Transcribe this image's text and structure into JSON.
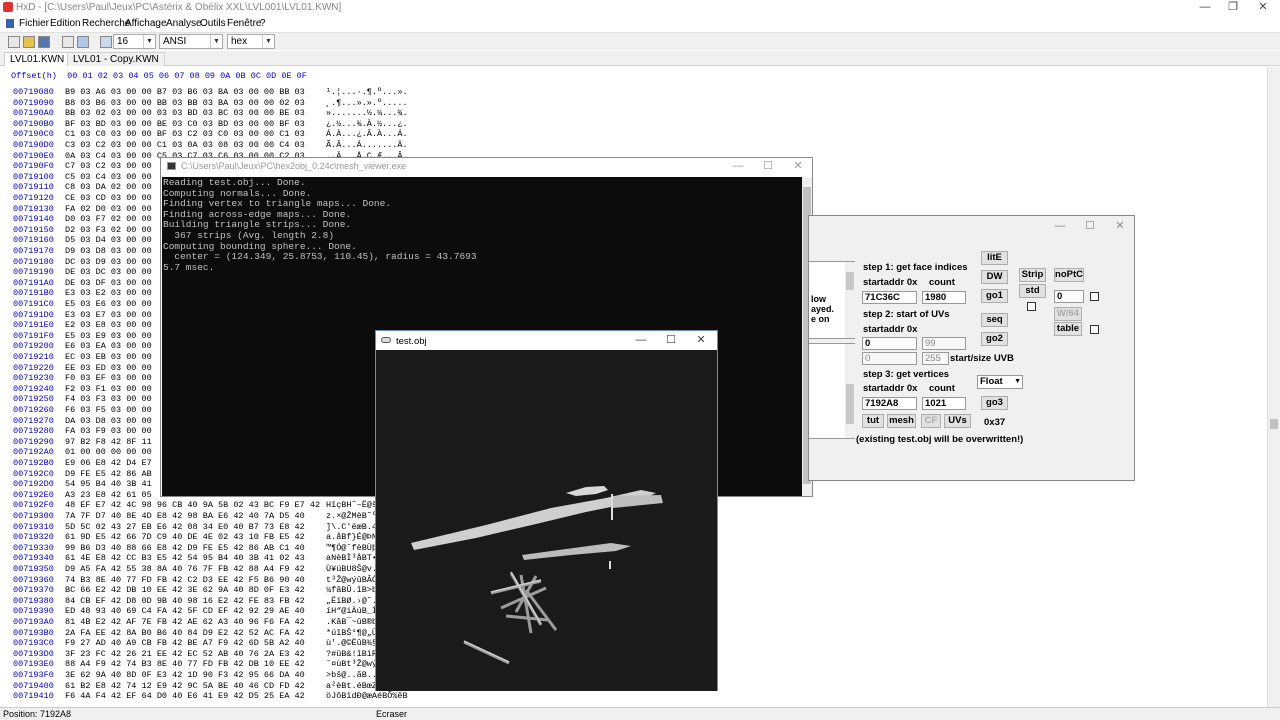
{
  "hxd": {
    "title": "HxD - [C:\\Users\\Paul\\Jeux\\PC\\Astérix & Obélix XXL\\LVL001\\LVL01.KWN]",
    "menu": [
      "Fichier",
      "Edition",
      "Recherche",
      "Affichage",
      "Analyse",
      "Outils",
      "Fenêtre",
      "?"
    ],
    "toolbar": {
      "columns": "16",
      "charset": "ANSI",
      "mode": "hex"
    },
    "tabs": [
      "LVL01.KWN",
      "LVL01 - Copy.KWN"
    ],
    "header": "Offset(h)  00 01 02 03 04 05 06 07 08 09 0A 0B 0C 0D 0E 0F",
    "rows": [
      {
        "o": "00719080",
        "h": "B9 03 A6 03 00 00 B7 03 B6 03 BA 03 00 00 BB 03",
        "t": "¹.¦...·.¶.º...»."
      },
      {
        "o": "00719090",
        "h": "B8 03 B6 03 00 00 BB 03 BB 03 BA 03 00 00 02 03",
        "t": "¸.¶...».».º....."
      },
      {
        "o": "007190A0",
        "h": "BB 03 02 03 00 00 03 03 BD 03 BC 03 00 00 BE 03",
        "t": "».......½.¼...¾."
      },
      {
        "o": "007190B0",
        "h": "BF 03 BD 03 00 00 BE 03 C0 03 BD 03 00 00 BF 03",
        "t": "¿.½...¾.À.½...¿."
      },
      {
        "o": "007190C0",
        "h": "C1 03 C0 03 00 00 BF 03 C2 03 C0 03 00 00 C1 03",
        "t": "Á.À...¿.Â.À...Á."
      },
      {
        "o": "007190D0",
        "h": "C3 03 C2 03 00 00 C1 03 0A 03 08 03 00 00 C4 03",
        "t": "Ã.Â...Á.......Ä."
      },
      {
        "o": "007190E0",
        "h": "0A 03 C4 03 00 00 C5 03 C7 03 C6 03 00 00 C2 03",
        "t": "..Ä...Å.Ç.Æ...Â."
      },
      {
        "o": "007190F0",
        "h": "C7 03 C2 03 00 00",
        "t": ""
      },
      {
        "o": "00719100",
        "h": "C5 03 C4 03 00 00",
        "t": ""
      },
      {
        "o": "00719110",
        "h": "C8 03 DA 02 00 00",
        "t": ""
      },
      {
        "o": "00719120",
        "h": "CE 03 CD 03 00 00",
        "t": ""
      },
      {
        "o": "00719130",
        "h": "FA 02 D0 03 00 00",
        "t": ""
      },
      {
        "o": "00719140",
        "h": "D0 03 F7 02 00 00",
        "t": ""
      },
      {
        "o": "00719150",
        "h": "D2 03 F3 02 00 00",
        "t": ""
      },
      {
        "o": "00719160",
        "h": "D5 03 D4 03 00 00",
        "t": ""
      },
      {
        "o": "00719170",
        "h": "D9 03 D8 03 00 00",
        "t": ""
      },
      {
        "o": "00719180",
        "h": "DC 03 D9 03 00 00",
        "t": ""
      },
      {
        "o": "00719190",
        "h": "DE 03 DC 03 00 00",
        "t": ""
      },
      {
        "o": "007191A0",
        "h": "DE 03 DF 03 00 00",
        "t": ""
      },
      {
        "o": "007191B0",
        "h": "E3 03 E2 03 00 00",
        "t": ""
      },
      {
        "o": "007191C0",
        "h": "E5 03 E6 03 00 00",
        "t": ""
      },
      {
        "o": "007191D0",
        "h": "E3 03 E7 03 00 00",
        "t": ""
      },
      {
        "o": "007191E0",
        "h": "E2 03 E8 03 00 00",
        "t": ""
      },
      {
        "o": "007191F0",
        "h": "E5 03 E9 03 00 00",
        "t": ""
      },
      {
        "o": "00719200",
        "h": "E6 03 EA 03 00 00",
        "t": ""
      },
      {
        "o": "00719210",
        "h": "EC 03 EB 03 00 00",
        "t": ""
      },
      {
        "o": "00719220",
        "h": "EE 03 ED 03 00 00",
        "t": ""
      },
      {
        "o": "00719230",
        "h": "F0 03 EF 03 00 00",
        "t": ""
      },
      {
        "o": "00719240",
        "h": "F2 03 F1 03 00 00",
        "t": ""
      },
      {
        "o": "00719250",
        "h": "F4 03 F3 03 00 00",
        "t": ""
      },
      {
        "o": "00719260",
        "h": "F6 03 F5 03 00 00",
        "t": ""
      },
      {
        "o": "00719270",
        "h": "DA 03 D8 03 00 00",
        "t": ""
      },
      {
        "o": "00719280",
        "h": "FA 03 F9 03 00 00",
        "t": ""
      },
      {
        "o": "00719290",
        "h": "97 B2 F8 42 8F 11",
        "t": ""
      },
      {
        "o": "007192A0",
        "h": "01 00 00 00 00 00",
        "t": ""
      },
      {
        "o": "007192B0",
        "h": "E9 06 E8 42 D4 E7",
        "t": ""
      },
      {
        "o": "007192C0",
        "h": "D9 FE E5 42 86 AB",
        "t": ""
      },
      {
        "o": "007192D0",
        "h": "54 95 B4 40 3B 41",
        "t": ""
      },
      {
        "o": "007192E0",
        "h": "A3 23 E8 42 61 05",
        "t": ""
      },
      {
        "o": "007192F0",
        "h": "48 EF E7 42 4C 98 96 CB 40 9A 5B 02 43 BC F9 E7 42",
        "t": "HïçBH˜–Ë@š[.C¼ùçB"
      },
      {
        "o": "00719300",
        "h": "7A 7F D7 40 8E 4D E8 42 98 BA E6 42 40 7A D5 40",
        "t": "z.×@ŽMèB˜ºæB@zÕ@"
      },
      {
        "o": "00719310",
        "h": "5D 5C 02 43 27 EB E6 42 08 34 E0 40 B7 73 E8 42",
        "t": "]\\.C'ëæB.4à@·sèB"
      },
      {
        "o": "00719320",
        "h": "61 9D E5 42 66 7D C9 40 DE 4E 02 43 10 FB E5 42",
        "t": "a.åBf}É@ÞN.C.ûåB"
      },
      {
        "o": "00719330",
        "h": "99 B6 D3 40 88 66 E8 42 D9 FE E5 42 86 AB C1 40",
        "t": "™¶Ó@ˆfèBÙþåB†«Á@"
      },
      {
        "o": "00719340",
        "h": "61 4E E8 42 CC B3 E5 42 54 95 B4 40 3B 41 02 43",
        "t": "aNèBÌ³åBT•´@;A.C"
      },
      {
        "o": "00719350",
        "h": "D9 A5 FA 42 55 38 8A 40 76 7F FB 42 88 A4 F9 42",
        "t": "Ù¥úBU8Š@v.ûBˆ¤ùB"
      },
      {
        "o": "00719360",
        "h": "74 B3 8E 40 77 FD FB 42 C2 D3 EE 42 F5 B6 90 40",
        "t": "t³Ž@wýûBÂÓîBõ¶.@"
      },
      {
        "o": "00719370",
        "h": "BC 66 E2 42 DB 10 EE 42 3E 62 9A 40 8D 0F E3 42",
        "t": "¼fâBÛ.îB>bš@..ãB"
      },
      {
        "o": "00719380",
        "h": "84 CB EF 42 D8 0D 9B 40 98 16 E2 42 FE 83 FB 42",
        "t": "„ËïBØ.›@˜.âBþƒûB"
      },
      {
        "o": "00719390",
        "h": "ED 48 93 40 69 C4 FA 42 5F CD EF 42 92 29 AE 40",
        "t": "íH“@iÄúB_ÍïB’)®@"
      },
      {
        "o": "007193A0",
        "h": "81 4B E2 42 AF 7E FB 42 AE 62 A3 40 96 F6 FA 42",
        "t": ".KâB¯~ûB®b£@–öúB"
      },
      {
        "o": "007193B0",
        "h": "2A FA EE 42 8A B0 B6 40 84 D9 E2 42 52 AC FA 42",
        "t": "*úîBŠ°¶@„ÙâBR¬úB"
      },
      {
        "o": "007193C0",
        "h": "F9 27 AD 40 A9 CB FB 42 BE A7 F9 42 6D 5B A2 40",
        "t": "ù'.@©ËûB¾§ùBm[¢@"
      },
      {
        "o": "007193D0",
        "h": "3F 23 FC 42 26 21 EE 42 EC 52 AB 40 76 2A E3 42",
        "t": "?#üB&!îBìR«@v*ãB"
      },
      {
        "o": "007193E0",
        "h": "88 A4 F9 42 74 B3 8E 40 77 FD FB 42 DB 10 EE 42",
        "t": "ˆ¤ùBt³Ž@wýûBÛ.îB"
      },
      {
        "o": "007193F0",
        "h": "3E 62 9A 40 8D 0F E3 42 1D 90 F3 42 95 66 DA 40",
        "t": ">bš@..ãB..óB•fÚ@"
      },
      {
        "o": "00719400",
        "h": "61 B2 E8 42 74 12 E9 42 9C 5A BE 40 46 CD FD 42",
        "t": "a²èBt.éBœZ¾@FÍýB"
      },
      {
        "o": "00719410",
        "h": "F6 4A F4 42 EF 64 D0 40 E6 41 E9 42 D5 25 EA 42",
        "t": "öJôBïdÐ@æAéBÕ%êB"
      }
    ],
    "status": {
      "position": "Position: 7192A8",
      "mode": "Ecraser"
    }
  },
  "console": {
    "title": "C:\\Users\\Paul\\Jeux\\PC\\hex2obj_0.24c\\mesh_viewer.exe",
    "lines": [
      "Reading test.obj... Done.",
      "Computing normals... Done.",
      "Finding vertex to triangle maps... Done.",
      "Finding across-edge maps... Done.",
      "Building triangle strips... Done.",
      "  367 strips (Avg. length 2.8)",
      "Computing bounding sphere... Done.",
      "  center = (124.349, 25.8753, 110.45), radius = 43.7693",
      "5.7 msec."
    ]
  },
  "tool": {
    "left_panel_text": [
      "low",
      "ayed.",
      "e on"
    ],
    "step1": "step 1: get face indices",
    "startaddr": "startaddr 0x",
    "count": "count",
    "face_addr": "71C36C",
    "face_count": "1980",
    "step2": "step 2: start of UVs",
    "uv_addr": "0",
    "uv_val": "99",
    "uvb_start": "0",
    "uvb_size": "255",
    "uvb_label": "start/size UVB",
    "step3": "step 3: get vertices",
    "vert_addr": "7192A8",
    "vert_count": "1021",
    "float_select": "Float",
    "hex_display": "0x37",
    "overwrite_note": "(existing test.obj will be overwritten!)",
    "buttons": {
      "lite": "litE",
      "dw": "DW",
      "strip": "Strip",
      "noptc": "noPtC",
      "go1": "go1",
      "std": "std",
      "seq": "seq",
      "go2": "go2",
      "go3": "go3",
      "tut": "tut",
      "mesh": "mesh",
      "cf": "CF",
      "uvs": "UVs",
      "w64": "W/64",
      "table": "table"
    },
    "strip_field": "0"
  },
  "viewer": {
    "title": "test.obj"
  }
}
